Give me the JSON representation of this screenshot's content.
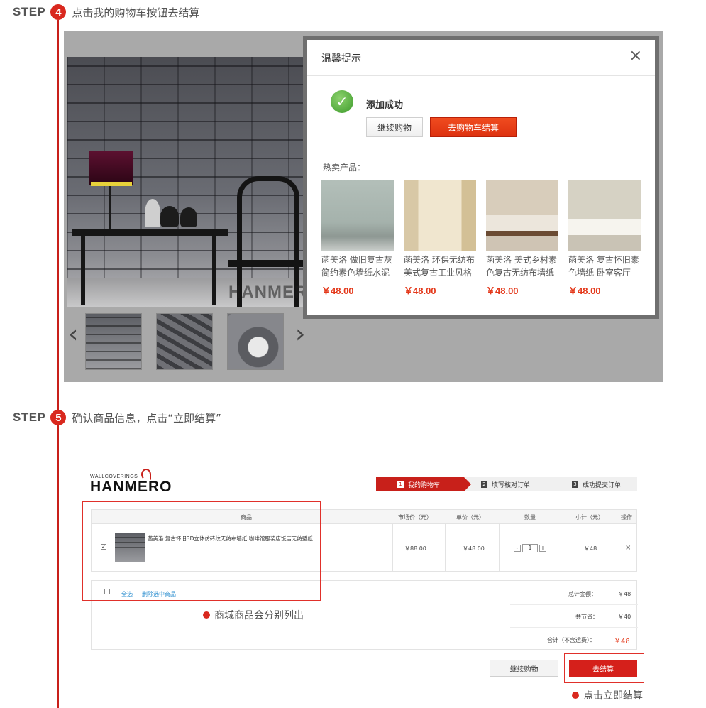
{
  "step4": {
    "word": "STEP",
    "number": "4",
    "description": "点击我的购物车按钮去结算",
    "gallery": {
      "watermark": "HANMERO",
      "prev_icon": "chevron-left-icon",
      "next_icon": "chevron-right-icon",
      "prev_glyph": "‹",
      "next_glyph": "›"
    },
    "dialog": {
      "title": "温馨提示",
      "close_glyph": "×",
      "check_glyph": "✓",
      "success_text": "添加成功",
      "continue_label": "继续购物",
      "checkout_label": "去购物车结算",
      "hot_label": "热卖产品：",
      "products": [
        {
          "name": "菡美洛 做旧复古灰简约素色墙纸水泥",
          "price": "￥48.00"
        },
        {
          "name": "菡美洛 环保无纺布美式复古工业风格",
          "price": "￥48.00"
        },
        {
          "name": "菡美洛 美式乡村素色复古无纺布墙纸",
          "price": "￥48.00"
        },
        {
          "name": "菡美洛 复古怀旧素色墙纸 卧室客厅",
          "price": "￥48.00"
        }
      ]
    }
  },
  "step5": {
    "word": "STEP",
    "number": "5",
    "description": "确认商品信息，点击“立即结算”",
    "logo": {
      "small": "WALLCOVERINGS",
      "big": "HANMERO"
    },
    "progress": [
      {
        "n": "1",
        "label": "我的购物车"
      },
      {
        "n": "2",
        "label": "填写核对订单"
      },
      {
        "n": "3",
        "label": "成功提交订单"
      }
    ],
    "table": {
      "headers": {
        "product": "商品",
        "market_price": "市场价（元）",
        "unit_price": "单价（元）",
        "qty": "数量",
        "subtotal": "小计（元）",
        "action": "操作"
      },
      "row": {
        "checked_glyph": "✓",
        "title": "菡美洛 复古怀旧3D立体仿砖纹无纺布墙纸 咖啡馆服装店饭店无纺壁纸",
        "market_price": "￥88.00",
        "unit_price": "￥48.00",
        "qty": "1",
        "minus": "-",
        "plus": "+",
        "subtotal": "￥48",
        "delete_glyph": "×"
      }
    },
    "summary": {
      "select_all": "全选",
      "delete_selected": "删除选中商品",
      "total_label": "总计金额：",
      "total_value": "￥48",
      "saved_label": "共节省：",
      "saved_value": "￥40",
      "sum_label": "合计（不含运费）：",
      "sum_value": "￥48"
    },
    "buttons": {
      "continue": "继续购物",
      "checkout": "去结算"
    },
    "notes": {
      "listed": "商城商品会分别列出",
      "checkout_now": "点击立即结算"
    }
  },
  "colors": {
    "accent": "#d9281e",
    "price": "#e4391b",
    "link": "#2b8ecf"
  }
}
